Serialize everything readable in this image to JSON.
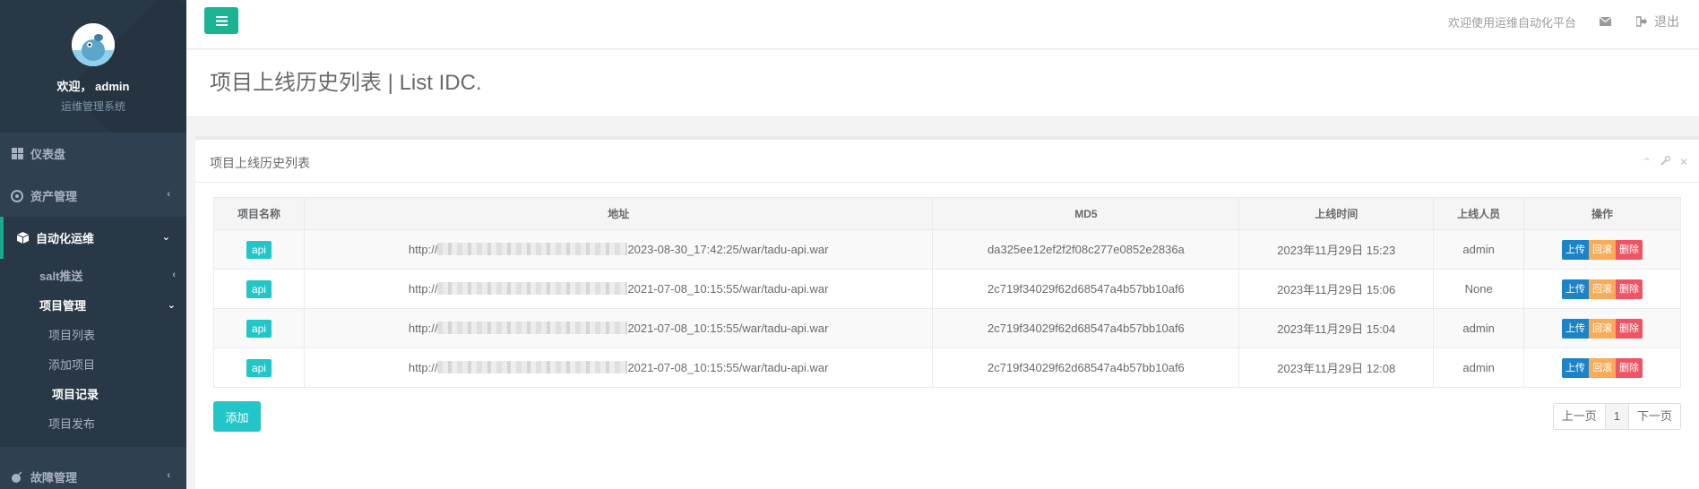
{
  "sidebar": {
    "welcome": "欢迎， admin",
    "subtitle": "运维管理系统",
    "items": [
      {
        "label": "仪表盘"
      },
      {
        "label": "资产管理"
      },
      {
        "label": "自动化运维"
      },
      {
        "label": "故障管理"
      }
    ],
    "sub": {
      "salt": "salt推送",
      "project": "项目管理",
      "project_items": [
        "项目列表",
        "添加项目",
        "项目记录",
        "项目发布"
      ]
    }
  },
  "topbar": {
    "welcome": "欢迎使用运维自动化平台",
    "logout": "退出"
  },
  "heading": {
    "title": "项目上线历史列表 | List IDC."
  },
  "panel": {
    "title": "项目上线历史列表",
    "columns": [
      "项目名称",
      "地址",
      "MD5",
      "上线时间",
      "上线人员",
      "操作"
    ],
    "rows": [
      {
        "name": "api",
        "addr_prefix": "http://",
        "addr_suffix": "2023-08-30_17:42:25/war/tadu-api.war",
        "md5": "da325ee12ef2f2f08c277e0852e2836a",
        "time": "2023年11月29日 15:23",
        "user": "admin"
      },
      {
        "name": "api",
        "addr_prefix": "http://",
        "addr_suffix": "2021-07-08_10:15:55/war/tadu-api.war",
        "md5": "2c719f34029f62d68547a4b57bb10af6",
        "time": "2023年11月29日 15:06",
        "user": "None"
      },
      {
        "name": "api",
        "addr_prefix": "http://",
        "addr_suffix": "2021-07-08_10:15:55/war/tadu-api.war",
        "md5": "2c719f34029f62d68547a4b57bb10af6",
        "time": "2023年11月29日 15:04",
        "user": "admin"
      },
      {
        "name": "api",
        "addr_prefix": "http://",
        "addr_suffix": "2021-07-08_10:15:55/war/tadu-api.war",
        "md5": "2c719f34029f62d68547a4b57bb10af6",
        "time": "2023年11月29日 12:08",
        "user": "admin"
      }
    ],
    "actions": {
      "upload": "上传",
      "rollback": "回滚",
      "delete": "删除"
    },
    "add_button": "添加",
    "pagination": {
      "prev": "上一页",
      "current": "1",
      "next": "下一页"
    }
  },
  "colors": {
    "sidebar": "#2f4050",
    "primary": "#1ab394",
    "info": "#23c6c8",
    "upload": "#1c84c6",
    "rollback": "#f8ac59",
    "delete": "#ed5565"
  },
  "icons": {
    "menu": "bars-icon",
    "mail": "envelope-icon",
    "logout": "sign-out-icon",
    "dashboard": "th-large-icon",
    "assets": "rebel-icon",
    "automation": "cube-icon",
    "fault": "bomb-icon"
  }
}
